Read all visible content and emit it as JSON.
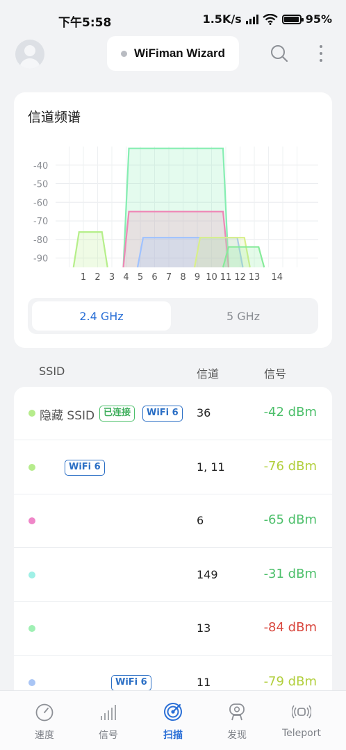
{
  "status_bar": {
    "time": "下午5:58",
    "net_speed": "1.5K/s",
    "battery": "95"
  },
  "header": {
    "title": "WiFiman Wizard"
  },
  "spectrum_card": {
    "title": "信道频谱",
    "bands": [
      "2.4 GHz",
      "5 GHz"
    ],
    "selected_band": "2.4 GHz"
  },
  "chart_data": {
    "type": "area",
    "y_ticks": [
      "-40",
      "-50",
      "-60",
      "-70",
      "-80",
      "-90"
    ],
    "x_ticks": [
      "1",
      "2",
      "3",
      "4",
      "5",
      "6",
      "7",
      "8",
      "9",
      "10",
      "11",
      "12",
      "13",
      "14"
    ],
    "ylim": [
      -95,
      -30
    ],
    "series": [
      {
        "channel_span": [
          0.5,
          2.5
        ],
        "peak": -76,
        "color": "#b6ef8a"
      },
      {
        "channel_span": [
          4,
          11
        ],
        "peak": -31,
        "color": "#86eeb2"
      },
      {
        "channel_span": [
          4,
          11
        ],
        "peak": -65,
        "color": "#ef86b6"
      },
      {
        "channel_span": [
          5,
          12
        ],
        "peak": -79,
        "color": "#9fc2ff"
      },
      {
        "channel_span": [
          9,
          12.5
        ],
        "peak": -79,
        "color": "#d8ef8a"
      },
      {
        "channel_span": [
          11,
          13.5
        ],
        "peak": -84,
        "color": "#86eb9a"
      }
    ]
  },
  "columns": {
    "ssid": "SSID",
    "channel": "信道",
    "signal": "信号"
  },
  "networks": [
    {
      "dot_color": "#b6ec8c",
      "ssid": "隐藏 SSID",
      "connected_badge": "已连接",
      "wifi6_badge": "WiFi 6",
      "channel": "36",
      "signal": "-42 dBm",
      "signal_color": "#4cbf6a"
    },
    {
      "dot_color": "#b6ec8c",
      "ssid": "",
      "connected_badge": "",
      "wifi6_badge": "WiFi 6",
      "channel": "1, 11",
      "signal": "-76 dBm",
      "signal_color": "#b2cf3d"
    },
    {
      "dot_color": "#ef86c8",
      "ssid": "",
      "connected_badge": "",
      "wifi6_badge": "",
      "channel": "6",
      "signal": "-65 dBm",
      "signal_color": "#4cbf6a"
    },
    {
      "dot_color": "#9ff0e6",
      "ssid": "",
      "connected_badge": "",
      "wifi6_badge": "",
      "channel": "149",
      "signal": "-31 dBm",
      "signal_color": "#4cbf6a"
    },
    {
      "dot_color": "#9ff0b4",
      "ssid": "",
      "connected_badge": "",
      "wifi6_badge": "",
      "channel": "13",
      "signal": "-84 dBm",
      "signal_color": "#d9473e"
    },
    {
      "dot_color": "#a9c5f5",
      "ssid": "",
      "connected_badge": "",
      "wifi6_badge": "WiFi 6",
      "channel": "11",
      "signal": "-79 dBm",
      "signal_color": "#b2cf3d"
    }
  ],
  "tabs": [
    {
      "label": "速度",
      "icon": "speedometer-icon"
    },
    {
      "label": "信号",
      "icon": "signal-bars-icon"
    },
    {
      "label": "扫描",
      "icon": "radar-scan-icon"
    },
    {
      "label": "发现",
      "icon": "discover-icon"
    },
    {
      "label": "Teleport",
      "icon": "teleport-icon"
    }
  ],
  "active_tab": "扫描"
}
